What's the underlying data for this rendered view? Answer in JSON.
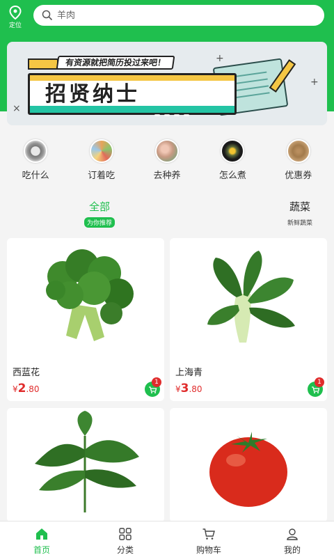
{
  "location": {
    "label": "定位",
    "icon": "location-pin-icon"
  },
  "search": {
    "placeholder": "羊肉",
    "icon": "search-icon"
  },
  "banner": {
    "ribbon": "有资源就把简历投过来吧！",
    "headline": "招贤纳士",
    "slide_count": 4,
    "active_slide": 1
  },
  "categories": [
    {
      "label": "吃什么",
      "icon": "what-to-eat-icon"
    },
    {
      "label": "订着吃",
      "icon": "order-to-eat-icon"
    },
    {
      "label": "去种养",
      "icon": "go-farming-icon"
    },
    {
      "label": "怎么煮",
      "icon": "how-to-cook-icon"
    },
    {
      "label": "优惠券",
      "icon": "coupon-icon"
    }
  ],
  "tabs": [
    {
      "title": "全部",
      "subtitle": "为你推荐",
      "active": true
    },
    {
      "title": "蔬菜",
      "subtitle": "新鲜蔬菜",
      "active": false
    }
  ],
  "products": [
    {
      "name": "西蓝花",
      "currency": "¥",
      "price_int": "2",
      "price_dec": ".80",
      "cart_count": "1",
      "image": "broccoli-image"
    },
    {
      "name": "上海青",
      "currency": "¥",
      "price_int": "3",
      "price_dec": ".80",
      "cart_count": "1",
      "image": "bok-choy-image"
    },
    {
      "name": "",
      "image": "sweet-potato-leaves-image"
    },
    {
      "name": "",
      "image": "tomato-image"
    }
  ],
  "nav": [
    {
      "label": "首页",
      "icon": "home-icon",
      "active": true
    },
    {
      "label": "分类",
      "icon": "category-grid-icon",
      "active": false
    },
    {
      "label": "购物车",
      "icon": "shopping-cart-icon",
      "active": false
    },
    {
      "label": "我的",
      "icon": "profile-icon",
      "active": false
    }
  ],
  "colors": {
    "brand": "#1fbf4e",
    "price": "#e02c2c",
    "badge": "#e02c2c"
  }
}
